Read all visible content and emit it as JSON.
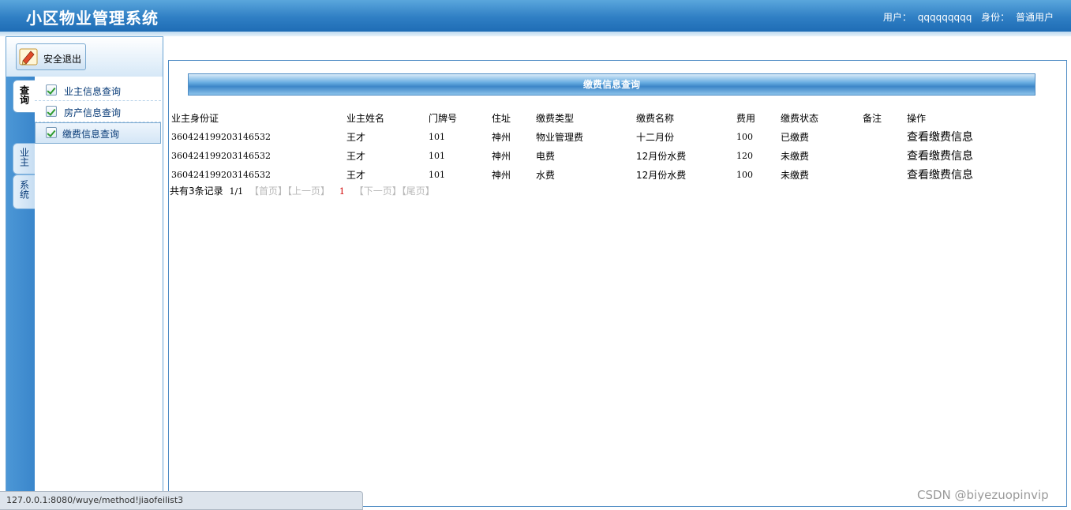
{
  "header": {
    "title": "小区物业管理系统",
    "user_label": "用户：",
    "user_name": "qqqqqqqqq",
    "role_label": "身份：",
    "role_value": "普通用户"
  },
  "sidebar": {
    "logout_label": "安全退出",
    "vertical_tabs": [
      {
        "label": "查询",
        "active": true
      },
      {
        "label": "业主",
        "active": false
      },
      {
        "label": "系统",
        "active": false
      }
    ],
    "menu_items": [
      {
        "label": "业主信息查询",
        "active": false
      },
      {
        "label": "房产信息查询",
        "active": false
      },
      {
        "label": "缴费信息查询",
        "active": true
      }
    ]
  },
  "main": {
    "panel_title": "缴费信息查询",
    "columns": [
      "业主身份证",
      "业主姓名",
      "门牌号",
      "住址",
      "缴费类型",
      "缴费名称",
      "费用",
      "缴费状态",
      "备注",
      "操作"
    ],
    "rows": [
      {
        "id_card": "360424199203146532",
        "name": "王才",
        "door_no": "101",
        "address": "神州",
        "fee_type": "物业管理费",
        "fee_name": "十二月份",
        "amount": "100",
        "status": "已缴费",
        "remark": "",
        "action": "查看缴费信息"
      },
      {
        "id_card": "360424199203146532",
        "name": "王才",
        "door_no": "101",
        "address": "神州",
        "fee_type": "电费",
        "fee_name": "12月份水费",
        "amount": "120",
        "status": "未缴费",
        "remark": "",
        "action": "查看缴费信息"
      },
      {
        "id_card": "360424199203146532",
        "name": "王才",
        "door_no": "101",
        "address": "神州",
        "fee_type": "水费",
        "fee_name": "12月份水费",
        "amount": "100",
        "status": "未缴费",
        "remark": "",
        "action": "查看缴费信息"
      }
    ],
    "pager": {
      "total_text": "共有3条记录",
      "page_info": "1/1",
      "first": "【首页】",
      "prev": "【上一页】",
      "current": "1",
      "next": "【下一页】",
      "last": "【尾页】"
    }
  },
  "status_bar": {
    "url": "127.0.0.1:8080/wuye/method!jiaofeilist3"
  },
  "watermark": "CSDN @biyezuopinvip",
  "colors": {
    "header_blue": "#2f7fc4",
    "panel_border": "#4e8cc4",
    "pager_current": "#d00000"
  }
}
